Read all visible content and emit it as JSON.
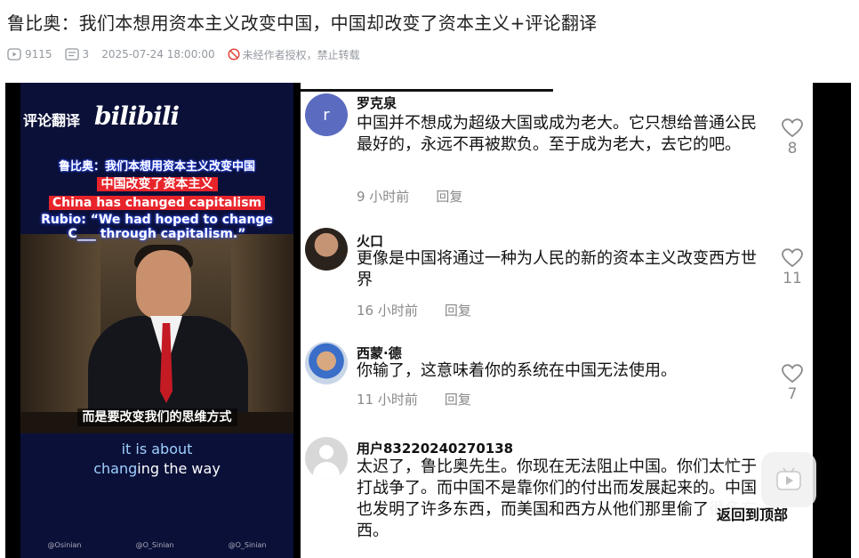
{
  "article": {
    "title": "鲁比奥：我们本想用资本主义改变中国，中国却改变了资本主义+评论翻译",
    "views": "9115",
    "comments_count": "3",
    "datetime": "2025-07-24 18:00:00",
    "notice": "未经作者授权，禁止转载"
  },
  "video": {
    "channel_label": "评论翻译",
    "logo_text": "bilibili",
    "caption_1": "鲁比奥：我们本想用资本主义改变中国",
    "caption_2": "中国改变了资本主义",
    "caption_3": "China has changed capitalism",
    "caption_4": "Rubio: “We had hoped to change",
    "caption_5": "C___ through capitalism.”",
    "subtitle_cn": "而是要改变我们的思维方式",
    "subtitle_en_1": "it is about",
    "subtitle_en_2a": "chang",
    "subtitle_en_2b": "ing the way",
    "footer": [
      "@Osinian",
      "@O_Sinian",
      "@O_Sinian"
    ]
  },
  "comments": [
    {
      "user": "罗克泉",
      "avatar_letter": "r",
      "avatar_color": "#5b6bc0",
      "text": "中国并不想成为超级大国或成为老大。它只想给普通公民最好的，永远不再被欺负。至于成为老大，去它的吧。",
      "time": "9 小时前",
      "reply": "回复",
      "likes": "8"
    },
    {
      "user": "火口",
      "text": "更像是中国将通过一种为人民的新的资本主义改变西方世界",
      "time": "16 小时前",
      "reply": "回复",
      "likes": "11"
    },
    {
      "user": "西蒙·德",
      "text": "你输了，这意味着你的系统在中国无法使用。",
      "time": "11 小时前",
      "reply": "回复",
      "likes": "7"
    },
    {
      "user": "用户83220240270138",
      "text": "太迟了，鲁比奥先生。你现在无法阻止中国。你们太忙于打战争了。而中国不是靠你们的付出而发展起来的。中国也发明了许多东西，而美国和西方从他们那里偷了很多东西。"
    }
  ],
  "back_to_top": "返回到顶部"
}
